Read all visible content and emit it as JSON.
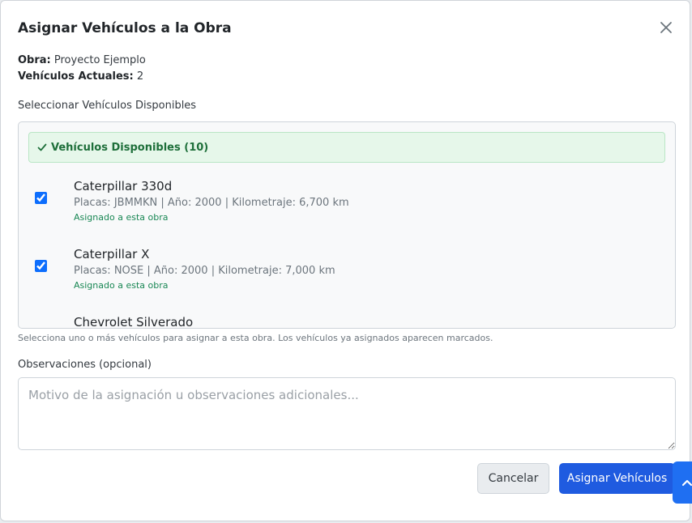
{
  "modal": {
    "title": "Asignar Vehículos a la Obra",
    "obra_label": "Obra:",
    "obra_value": "Proyecto Ejemplo",
    "current_label": "Vehículos Actuales:",
    "current_value": "2"
  },
  "selection": {
    "label": "Seleccionar Vehículos Disponibles",
    "available_header": "Vehículos Disponibles (10)",
    "vehicles": [
      {
        "name": "Caterpillar 330d",
        "details": "Placas: JBMMKN | Año: 2000 | Kilometraje: 6,700 km",
        "status": "Asignado a esta obra",
        "checked": true
      },
      {
        "name": "Caterpillar X",
        "details": "Placas: NOSE | Año: 2000 | Kilometraje: 7,000 km",
        "status": "Asignado a esta obra",
        "checked": true
      },
      {
        "name": "Chevrolet Silverado",
        "details": "",
        "status": "",
        "checked": false
      }
    ],
    "help_text": "Selecciona uno o más vehículos para asignar a esta obra. Los vehículos ya asignados aparecen marcados."
  },
  "notes": {
    "label": "Observaciones (opcional)",
    "placeholder": "Motivo de la asignación u observaciones adicionales...",
    "value": ""
  },
  "actions": {
    "cancel_label": "Cancelar",
    "submit_label": "Asignar Vehículos"
  },
  "icons": {
    "close": "close-icon",
    "check": "check-icon",
    "scroll_top": "chevron-up-icon"
  },
  "colors": {
    "primary": "#1f5be0",
    "success": "#198754",
    "success_bg": "#e6f7ea"
  }
}
